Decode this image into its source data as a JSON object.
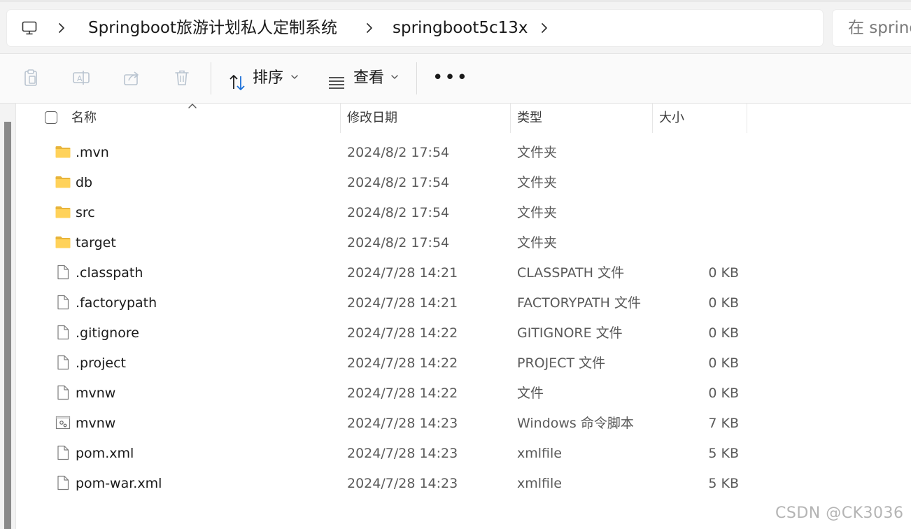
{
  "address_bar": {
    "breadcrumbs": [
      "Springboot旅游计划私人定制系统",
      "springboot5c13x"
    ],
    "search_placeholder": "在 spring"
  },
  "toolbar": {
    "sort_label": "排序",
    "view_label": "查看",
    "more_label": "•••"
  },
  "columns": {
    "name": "名称",
    "modified": "修改日期",
    "type": "类型",
    "size": "大小"
  },
  "files": [
    {
      "name": ".mvn",
      "modified": "2024/8/2 17:54",
      "type": "文件夹",
      "size": "",
      "icon": "folder-icon"
    },
    {
      "name": "db",
      "modified": "2024/8/2 17:54",
      "type": "文件夹",
      "size": "",
      "icon": "folder-icon"
    },
    {
      "name": "src",
      "modified": "2024/8/2 17:54",
      "type": "文件夹",
      "size": "",
      "icon": "folder-icon"
    },
    {
      "name": "target",
      "modified": "2024/8/2 17:54",
      "type": "文件夹",
      "size": "",
      "icon": "folder-icon"
    },
    {
      "name": ".classpath",
      "modified": "2024/7/28 14:21",
      "type": "CLASSPATH 文件",
      "size": "0 KB",
      "icon": "file-icon"
    },
    {
      "name": ".factorypath",
      "modified": "2024/7/28 14:21",
      "type": "FACTORYPATH 文件",
      "size": "0 KB",
      "icon": "file-icon"
    },
    {
      "name": ".gitignore",
      "modified": "2024/7/28 14:22",
      "type": "GITIGNORE 文件",
      "size": "0 KB",
      "icon": "file-icon"
    },
    {
      "name": ".project",
      "modified": "2024/7/28 14:22",
      "type": "PROJECT 文件",
      "size": "0 KB",
      "icon": "file-icon"
    },
    {
      "name": "mvnw",
      "modified": "2024/7/28 14:22",
      "type": "文件",
      "size": "0 KB",
      "icon": "file-icon"
    },
    {
      "name": "mvnw",
      "modified": "2024/7/28 14:23",
      "type": "Windows 命令脚本",
      "size": "7 KB",
      "icon": "script-file-icon"
    },
    {
      "name": "pom.xml",
      "modified": "2024/7/28 14:23",
      "type": "xmlfile",
      "size": "5 KB",
      "icon": "file-icon"
    },
    {
      "name": "pom-war.xml",
      "modified": "2024/7/28 14:23",
      "type": "xmlfile",
      "size": "5 KB",
      "icon": "file-icon"
    }
  ],
  "watermark": "CSDN @CK3036"
}
